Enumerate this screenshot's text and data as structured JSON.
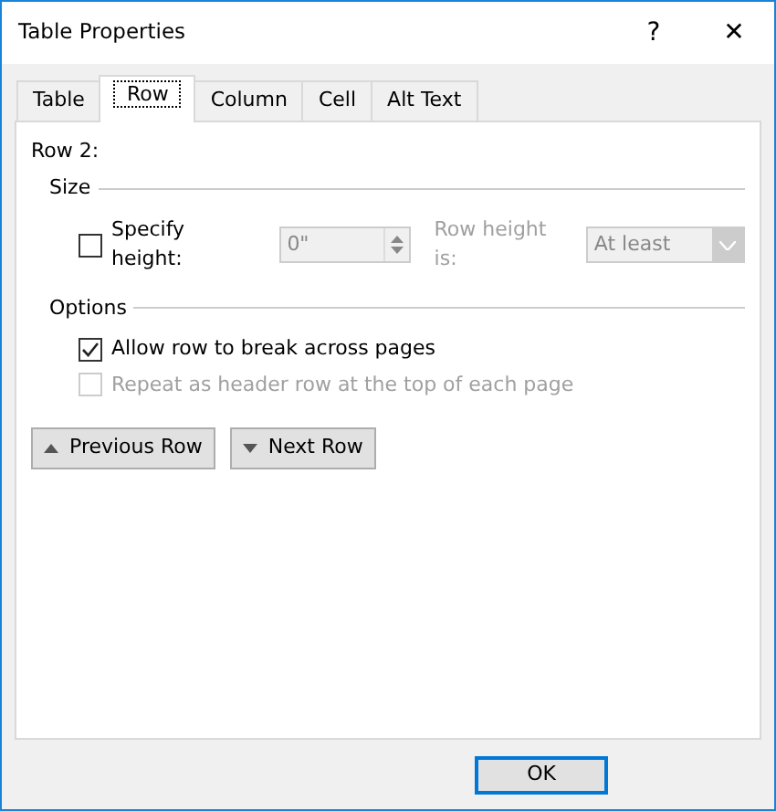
{
  "window": {
    "title": "Table Properties",
    "help": "?",
    "close": "✕"
  },
  "tabs": [
    {
      "label": "Table",
      "selected": false
    },
    {
      "label": "Row",
      "selected": true
    },
    {
      "label": "Column",
      "selected": false
    },
    {
      "label": "Cell",
      "selected": false
    },
    {
      "label": "Alt Text",
      "selected": false
    }
  ],
  "row_label": "Row 2:",
  "size": {
    "heading": "Size",
    "specify_height": {
      "label": "Specify height:",
      "checked": false
    },
    "height_field": {
      "value": "0\"",
      "disabled": true
    },
    "row_height_label": "Row height is:",
    "row_height_select": {
      "value": "At least",
      "disabled": true
    }
  },
  "options": {
    "heading": "Options",
    "items": [
      {
        "label": "Allow row to break across pages",
        "checked": true,
        "disabled": false
      },
      {
        "label": "Repeat as header row at the top of each page",
        "checked": false,
        "disabled": true
      }
    ]
  },
  "nav_buttons": [
    {
      "label": "Previous Row",
      "kind": "up"
    },
    {
      "label": "Next Row",
      "kind": "down"
    }
  ],
  "footer_buttons": [
    {
      "label": "OK",
      "selected": true
    }
  ]
}
